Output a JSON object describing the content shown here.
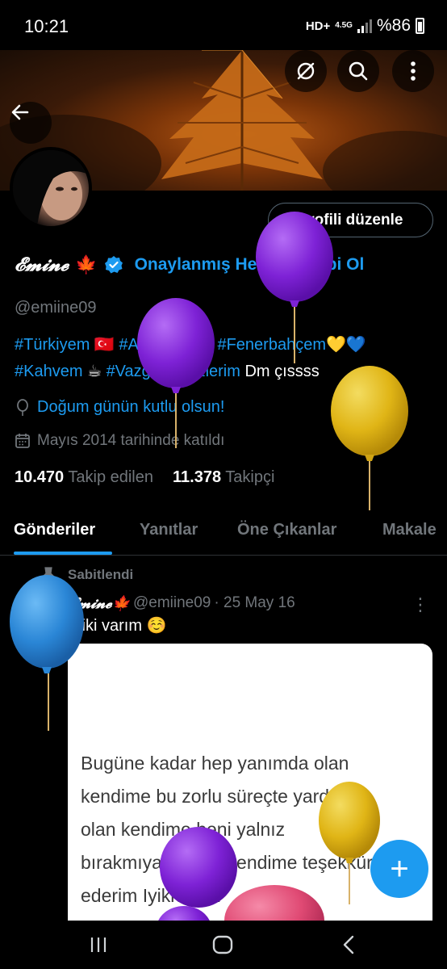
{
  "status_bar": {
    "time": "10:21",
    "network": "HD+",
    "network_type": "4.5G",
    "battery": "%86"
  },
  "header": {
    "back_icon": "back-arrow-icon",
    "actions": [
      "offline-icon",
      "search-icon",
      "more-vertical-icon"
    ]
  },
  "profile": {
    "edit_button": "Profili düzenle",
    "display_name": "𝓔𝓶𝓲𝓷𝓮",
    "name_emoji": "🍁",
    "verify_link": "Onaylanmış Hesap Sahibi Ol",
    "handle": "@emiine09",
    "bio_line1": {
      "tag1": "#Türkiyem",
      "flag": "🇹🇷",
      "tag2": "#Ailem",
      "emoji2": "👩‍👧💍",
      "tag3": "#Fenerbahçem",
      "emoji3": "💛💙"
    },
    "bio_line2": {
      "tag1": "#Kahvem",
      "emoji1": "☕",
      "tag2": "#Vazgeçilmezlerim",
      "text": "Dm çıssss"
    },
    "birthday": "Doğum günün kutlu olsun!",
    "joined": "Mayıs 2014 tarihinde katıldı",
    "following_count": "10.470",
    "following_label": "Takip edilen",
    "followers_count": "11.378",
    "followers_label": "Takipçi"
  },
  "tabs": [
    "Gönderiler",
    "Yanıtlar",
    "Öne Çıkanlar",
    "Makale"
  ],
  "active_tab": "Gönderiler",
  "post": {
    "pinned_label": "Sabitlendi",
    "author": "𝓔𝓶𝓲𝓷𝓮🍁",
    "handle": "@emiine09",
    "date": "· 25 May 16",
    "text": "Iyiki varım ☺️",
    "image_lines": [
      "Bugüne kadar hep yanımda olan",
      "kendime bu zorlu süreçte yardımcı",
      "olan kendime beni yalnız",
      "bırakmıyan kendi kendime teşekkür",
      "ederim Iyikivarım"
    ]
  },
  "fab_label": "+",
  "colors": {
    "accent": "#1d9bf0",
    "balloon_purple": "#8a2be2",
    "balloon_yellow": "#e8c21a",
    "balloon_blue": "#2a8ee0",
    "balloon_pink": "#e8507a"
  }
}
